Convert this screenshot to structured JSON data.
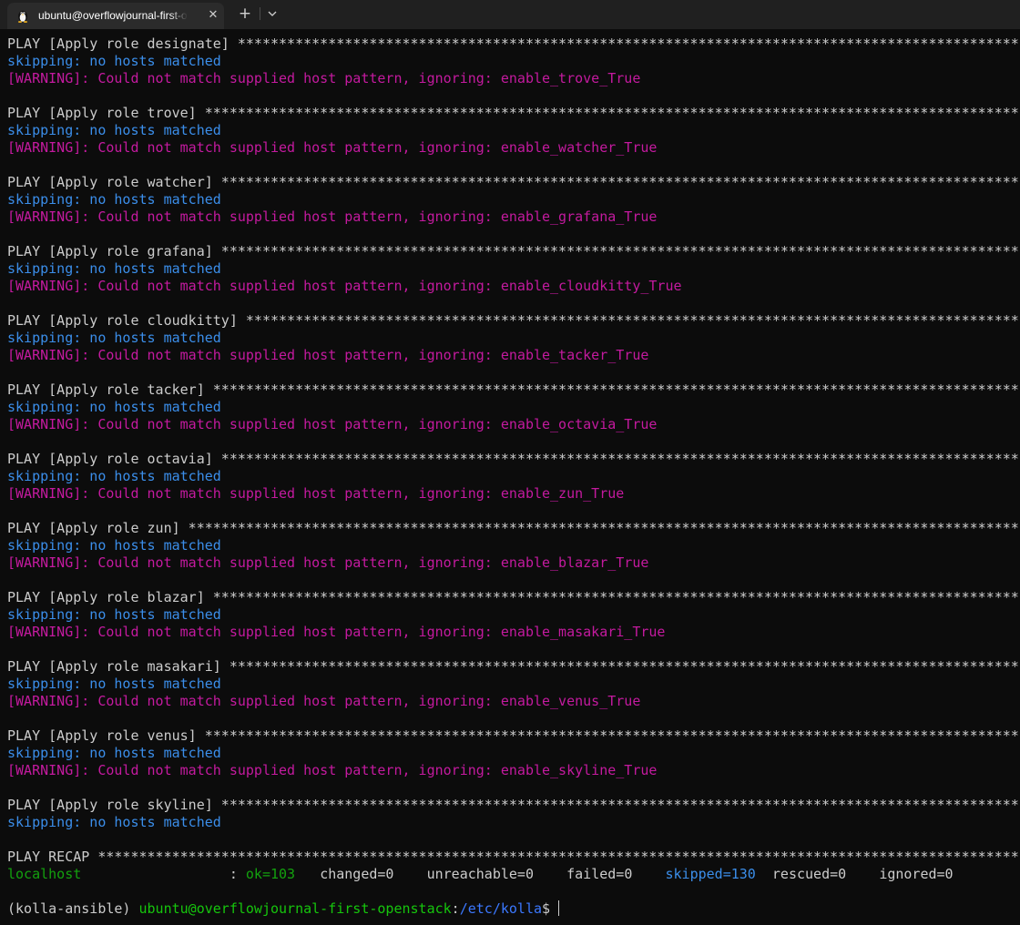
{
  "tab": {
    "title": "ubuntu@overflowjournal-first-openstack: /etc/kolla",
    "icon": "linux-tux-icon",
    "close_symbol": "✕",
    "new_tab_symbol": "+",
    "dropdown_icon": "chevron-down-icon"
  },
  "colors": {
    "background": "#0c0c0c",
    "default_text": "#cccccc",
    "skipping": "#3b8eea",
    "warning": "#c41a9f",
    "ok": "#13a10e",
    "prompt_user": "#16c60c",
    "prompt_path": "#3b78ff"
  },
  "terminal": {
    "lines": [
      {
        "type": "play",
        "text": "PLAY [Apply role designate] ******************************************************************************************************"
      },
      {
        "type": "skip",
        "text": "skipping: no hosts matched"
      },
      {
        "type": "warn",
        "text": "[WARNING]: Could not match supplied host pattern, ignoring: enable_trove_True"
      },
      {
        "type": "blank",
        "text": ""
      },
      {
        "type": "play",
        "text": "PLAY [Apply role trove] **********************************************************************************************************"
      },
      {
        "type": "skip",
        "text": "skipping: no hosts matched"
      },
      {
        "type": "warn",
        "text": "[WARNING]: Could not match supplied host pattern, ignoring: enable_watcher_True"
      },
      {
        "type": "blank",
        "text": ""
      },
      {
        "type": "play",
        "text": "PLAY [Apply role watcher] ********************************************************************************************************"
      },
      {
        "type": "skip",
        "text": "skipping: no hosts matched"
      },
      {
        "type": "warn",
        "text": "[WARNING]: Could not match supplied host pattern, ignoring: enable_grafana_True"
      },
      {
        "type": "blank",
        "text": ""
      },
      {
        "type": "play",
        "text": "PLAY [Apply role grafana] ********************************************************************************************************"
      },
      {
        "type": "skip",
        "text": "skipping: no hosts matched"
      },
      {
        "type": "warn",
        "text": "[WARNING]: Could not match supplied host pattern, ignoring: enable_cloudkitty_True"
      },
      {
        "type": "blank",
        "text": ""
      },
      {
        "type": "play",
        "text": "PLAY [Apply role cloudkitty] *****************************************************************************************************"
      },
      {
        "type": "skip",
        "text": "skipping: no hosts matched"
      },
      {
        "type": "warn",
        "text": "[WARNING]: Could not match supplied host pattern, ignoring: enable_tacker_True"
      },
      {
        "type": "blank",
        "text": ""
      },
      {
        "type": "play",
        "text": "PLAY [Apply role tacker] *********************************************************************************************************"
      },
      {
        "type": "skip",
        "text": "skipping: no hosts matched"
      },
      {
        "type": "warn",
        "text": "[WARNING]: Could not match supplied host pattern, ignoring: enable_octavia_True"
      },
      {
        "type": "blank",
        "text": ""
      },
      {
        "type": "play",
        "text": "PLAY [Apply role octavia] ********************************************************************************************************"
      },
      {
        "type": "skip",
        "text": "skipping: no hosts matched"
      },
      {
        "type": "warn",
        "text": "[WARNING]: Could not match supplied host pattern, ignoring: enable_zun_True"
      },
      {
        "type": "blank",
        "text": ""
      },
      {
        "type": "play",
        "text": "PLAY [Apply role zun] ************************************************************************************************************"
      },
      {
        "type": "skip",
        "text": "skipping: no hosts matched"
      },
      {
        "type": "warn",
        "text": "[WARNING]: Could not match supplied host pattern, ignoring: enable_blazar_True"
      },
      {
        "type": "blank",
        "text": ""
      },
      {
        "type": "play",
        "text": "PLAY [Apply role blazar] *********************************************************************************************************"
      },
      {
        "type": "skip",
        "text": "skipping: no hosts matched"
      },
      {
        "type": "warn",
        "text": "[WARNING]: Could not match supplied host pattern, ignoring: enable_masakari_True"
      },
      {
        "type": "blank",
        "text": ""
      },
      {
        "type": "play",
        "text": "PLAY [Apply role masakari] *******************************************************************************************************"
      },
      {
        "type": "skip",
        "text": "skipping: no hosts matched"
      },
      {
        "type": "warn",
        "text": "[WARNING]: Could not match supplied host pattern, ignoring: enable_venus_True"
      },
      {
        "type": "blank",
        "text": ""
      },
      {
        "type": "play",
        "text": "PLAY [Apply role venus] **********************************************************************************************************"
      },
      {
        "type": "skip",
        "text": "skipping: no hosts matched"
      },
      {
        "type": "warn",
        "text": "[WARNING]: Could not match supplied host pattern, ignoring: enable_skyline_True"
      },
      {
        "type": "blank",
        "text": ""
      },
      {
        "type": "play",
        "text": "PLAY [Apply role skyline] ********************************************************************************************************"
      },
      {
        "type": "skip",
        "text": "skipping: no hosts matched"
      },
      {
        "type": "blank",
        "text": ""
      },
      {
        "type": "play",
        "text": "PLAY RECAP ***********************************************************************************************************************"
      }
    ],
    "recap": {
      "host": "localhost",
      "colon": ": ",
      "ok": "ok=103",
      "changed": "changed=0",
      "unreachable": "unreachable=0",
      "failed": "failed=0",
      "skipped": "skipped=130",
      "rescued": "rescued=0",
      "ignored": "ignored=0"
    },
    "prompt": {
      "env": "(kolla-ansible) ",
      "user_host": "ubuntu@overflowjournal-first-openstack",
      "sep": ":",
      "path": "/etc/kolla",
      "symbol": "$ "
    }
  }
}
